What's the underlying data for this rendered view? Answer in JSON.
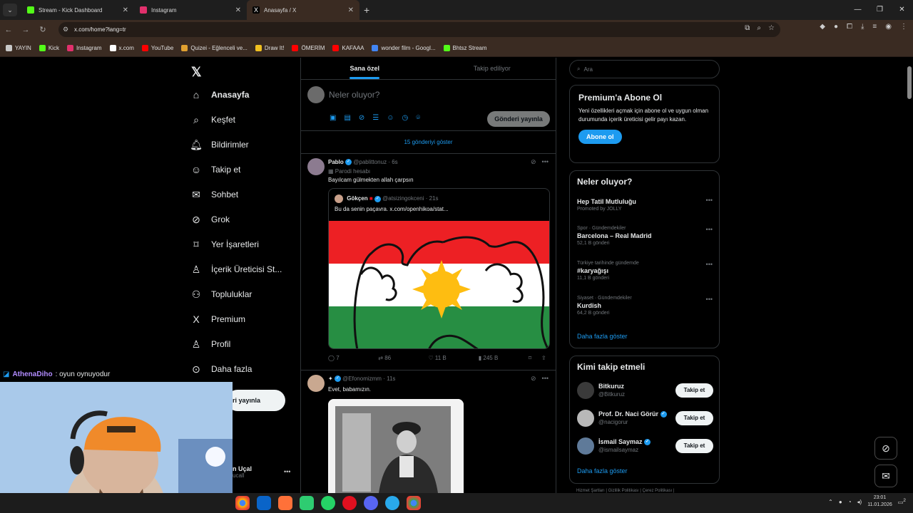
{
  "browser": {
    "tabs": [
      {
        "title": "Stream - Kick Dashboard",
        "color": "#53fc18"
      },
      {
        "title": "Instagram",
        "color": "#e1306c"
      },
      {
        "title": "Anasayfa / X",
        "color": "#ffffff"
      }
    ],
    "url": "x.com/home?lang=tr",
    "bookmarks": [
      {
        "label": "YAYIN",
        "icon": "folder-icon",
        "color": "#c8c8c8"
      },
      {
        "label": "Kick",
        "icon": "kick-icon",
        "color": "#53fc18"
      },
      {
        "label": "Instagram",
        "icon": "instagram-icon",
        "color": "#e1306c"
      },
      {
        "label": "x.com",
        "icon": "x-icon",
        "color": "#ffffff"
      },
      {
        "label": "YouTube",
        "icon": "youtube-icon",
        "color": "#ff0000"
      },
      {
        "label": "Quizei - Eğlenceli ve...",
        "icon": "quizei-icon",
        "color": "#e0a030"
      },
      {
        "label": "Draw It!",
        "icon": "draw-icon",
        "color": "#f0c020"
      },
      {
        "label": "ÖMERİM",
        "icon": "youtube-icon",
        "color": "#ff0000"
      },
      {
        "label": "KAFAAA",
        "icon": "youtube-icon",
        "color": "#ff0000"
      },
      {
        "label": "wonder film - Googl...",
        "icon": "google-icon",
        "color": "#4285f4"
      },
      {
        "label": "Bhtsz Stream",
        "icon": "kick-icon",
        "color": "#53fc18"
      }
    ]
  },
  "nav": {
    "items": [
      {
        "label": "Anasayfa",
        "icon": "home-icon",
        "glyph": "⌂"
      },
      {
        "label": "Keşfet",
        "icon": "search-icon",
        "glyph": "⌕"
      },
      {
        "label": "Bildirimler",
        "icon": "bell-icon",
        "glyph": "🔔︎"
      },
      {
        "label": "Takip et",
        "icon": "add-user-icon",
        "glyph": "☺"
      },
      {
        "label": "Sohbet",
        "icon": "mail-icon",
        "glyph": "✉"
      },
      {
        "label": "Grok",
        "icon": "grok-icon",
        "glyph": "⊘"
      },
      {
        "label": "Yer İşaretleri",
        "icon": "bookmark-icon",
        "glyph": "⌑"
      },
      {
        "label": "İçerik Üreticisi St...",
        "icon": "creator-icon",
        "glyph": "♙"
      },
      {
        "label": "Topluluklar",
        "icon": "communities-icon",
        "glyph": "⚇"
      },
      {
        "label": "Premium",
        "icon": "x-premium-icon",
        "glyph": "X"
      },
      {
        "label": "Profil",
        "icon": "profile-icon",
        "glyph": "♙"
      },
      {
        "label": "Daha fazla",
        "icon": "more-icon",
        "glyph": "⊙"
      }
    ],
    "post_button": "ri yayınla",
    "profile_name": "n Uçal",
    "profile_handle": "ucall"
  },
  "feed": {
    "tabs": [
      "Sana özel",
      "Takip ediliyor"
    ],
    "composer_placeholder": "Neler oluyor?",
    "composer_button": "Gönderi yayınla",
    "show_more": "15 gönderiyi göster",
    "post1": {
      "name": "Pablo",
      "handle": "@pablittonuz",
      "time": "6s",
      "parody": "Parodi hesabı",
      "text": "Bayılcam gülmekten allah çarpsın",
      "quote_name": "Gökçen",
      "quote_handle": "@atsizingokceni",
      "quote_time": "21s",
      "quote_text": "Bu da senin paçavra.  x.com/openhikoa/stat...",
      "replies": "7",
      "reposts": "86",
      "likes": "11 B",
      "views": "245 B"
    },
    "post2": {
      "name": "",
      "handle": "@Efonomizmm",
      "time": "11s",
      "text": "Evet, babamızın."
    }
  },
  "right": {
    "search_placeholder": "Ara",
    "premium_title": "Premium'a Abone Ol",
    "premium_text": "Yeni özellikleri açmak için abone ol ve uygun olman durumunda içerik üreticisi gelir payı kazan.",
    "premium_button": "Abone ol",
    "trends_title": "Neler oluyor?",
    "trends": [
      {
        "context": "",
        "title": "Hep Tatil Mutluluğu",
        "posts": "Promoted by JOLLY"
      },
      {
        "context": "Spor · Gündemdekiler",
        "title": "Barcelona – Real Madrid",
        "posts": "52,1 B gönderi"
      },
      {
        "context": "Türkiye tarihinde gündemde",
        "title": "#karyağışı",
        "posts": "11,1 B gönderi"
      },
      {
        "context": "Siyaset · Gündemdekiler",
        "title": "Kurdish",
        "posts": "64,2 B gönderi"
      }
    ],
    "trends_more": "Daha fazla göster",
    "who_title": "Kimi takip etmeli",
    "who": [
      {
        "name": "Bitkuruz",
        "handle": "@Bitkuruz",
        "verified": false
      },
      {
        "name": "Prof. Dr. Naci Görür",
        "handle": "@nacigorur",
        "verified": true
      },
      {
        "name": "İsmail Saymaz",
        "handle": "@ismailsaymaz",
        "verified": true
      }
    ],
    "follow_label": "Takip et",
    "who_more": "Daha fazla göster",
    "footer": "Hizmet Şartları  |  Gizlilik Politikası  |  Çerez Politikası  |"
  },
  "stream": {
    "chat_user": "AthenaDiho",
    "chat_text": ": oyun oynuyodur"
  },
  "taskbar": {
    "time": "23:01",
    "date": "11.01.2026",
    "notif": "2"
  }
}
